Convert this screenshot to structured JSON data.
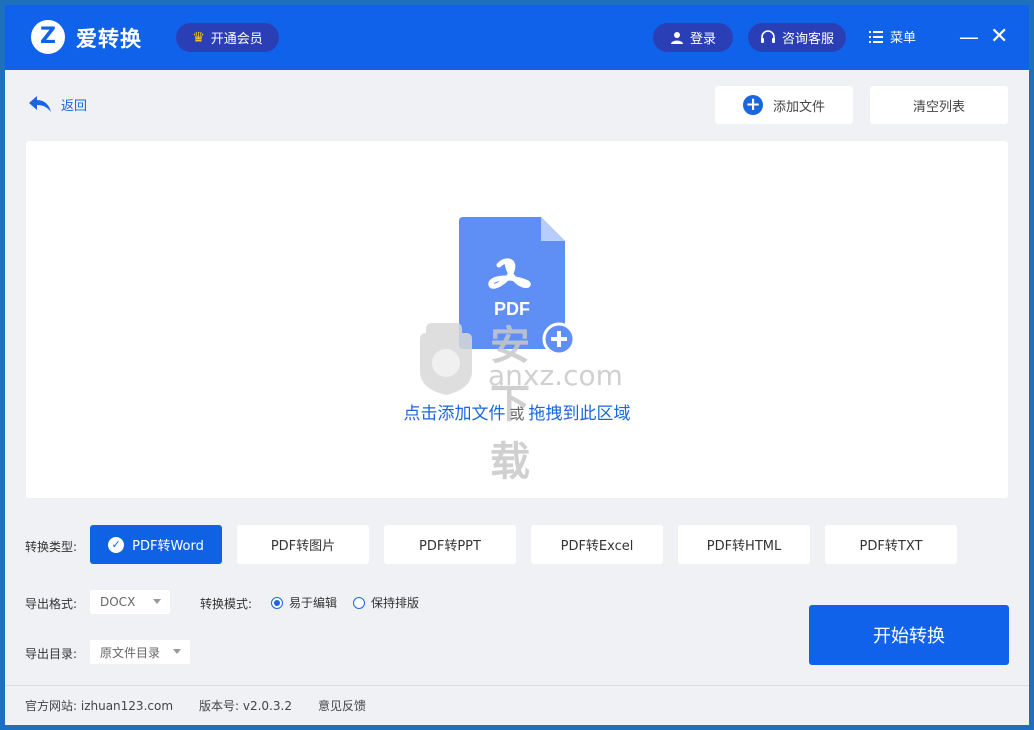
{
  "app": {
    "logo_letter": "Z",
    "title": "爱转换",
    "vip_label": "开通会员",
    "login_label": "登录",
    "service_label": "咨询客服",
    "menu_label": "菜单",
    "minimize": "—",
    "close": "✕"
  },
  "toolbar": {
    "back_label": "返回",
    "add_file_label": "添加文件",
    "clear_list_label": "清空列表"
  },
  "dropzone": {
    "file_badge": "PDF",
    "hint_click": "点击添加文件",
    "hint_or": "或",
    "hint_drag": "拖拽到此区域",
    "watermark_cn": "安下载",
    "watermark_en": "anxz.com"
  },
  "convert": {
    "type_label": "转换类型:",
    "types": [
      "PDF转Word",
      "PDF转图片",
      "PDF转PPT",
      "PDF转Excel",
      "PDF转HTML",
      "PDF转TXT"
    ],
    "active_type_index": 0,
    "format_label": "导出格式:",
    "format_value": "DOCX",
    "mode_label": "转换模式:",
    "mode_options": [
      "易于编辑",
      "保持排版"
    ],
    "mode_selected": "易于编辑",
    "dir_label": "导出目录:",
    "dir_value": "原文件目录",
    "start_label": "开始转换"
  },
  "footer": {
    "website": "官方网站:  izhuan123.com",
    "version": "版本号:  v2.0.3.2",
    "feedback": "意见反馈"
  },
  "colors": {
    "brand_blue": "#0f62e9",
    "pill_dark": "#2a3fb5",
    "crown_gold": "#ffc51a",
    "pdf_icon_blue": "#5f8ff5"
  }
}
